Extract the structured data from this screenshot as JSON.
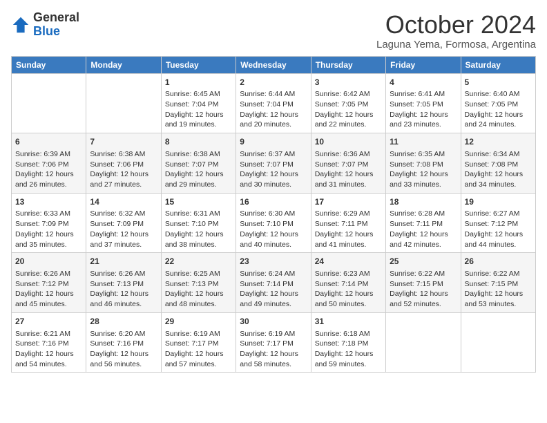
{
  "header": {
    "logo_general": "General",
    "logo_blue": "Blue",
    "month_title": "October 2024",
    "location": "Laguna Yema, Formosa, Argentina"
  },
  "days_of_week": [
    "Sunday",
    "Monday",
    "Tuesday",
    "Wednesday",
    "Thursday",
    "Friday",
    "Saturday"
  ],
  "weeks": [
    [
      {
        "day": "",
        "info": ""
      },
      {
        "day": "",
        "info": ""
      },
      {
        "day": "1",
        "sunrise": "6:45 AM",
        "sunset": "7:04 PM",
        "daylight": "12 hours and 19 minutes."
      },
      {
        "day": "2",
        "sunrise": "6:44 AM",
        "sunset": "7:04 PM",
        "daylight": "12 hours and 20 minutes."
      },
      {
        "day": "3",
        "sunrise": "6:42 AM",
        "sunset": "7:05 PM",
        "daylight": "12 hours and 22 minutes."
      },
      {
        "day": "4",
        "sunrise": "6:41 AM",
        "sunset": "7:05 PM",
        "daylight": "12 hours and 23 minutes."
      },
      {
        "day": "5",
        "sunrise": "6:40 AM",
        "sunset": "7:05 PM",
        "daylight": "12 hours and 24 minutes."
      }
    ],
    [
      {
        "day": "6",
        "sunrise": "6:39 AM",
        "sunset": "7:06 PM",
        "daylight": "12 hours and 26 minutes."
      },
      {
        "day": "7",
        "sunrise": "6:38 AM",
        "sunset": "7:06 PM",
        "daylight": "12 hours and 27 minutes."
      },
      {
        "day": "8",
        "sunrise": "6:38 AM",
        "sunset": "7:07 PM",
        "daylight": "12 hours and 29 minutes."
      },
      {
        "day": "9",
        "sunrise": "6:37 AM",
        "sunset": "7:07 PM",
        "daylight": "12 hours and 30 minutes."
      },
      {
        "day": "10",
        "sunrise": "6:36 AM",
        "sunset": "7:07 PM",
        "daylight": "12 hours and 31 minutes."
      },
      {
        "day": "11",
        "sunrise": "6:35 AM",
        "sunset": "7:08 PM",
        "daylight": "12 hours and 33 minutes."
      },
      {
        "day": "12",
        "sunrise": "6:34 AM",
        "sunset": "7:08 PM",
        "daylight": "12 hours and 34 minutes."
      }
    ],
    [
      {
        "day": "13",
        "sunrise": "6:33 AM",
        "sunset": "7:09 PM",
        "daylight": "12 hours and 35 minutes."
      },
      {
        "day": "14",
        "sunrise": "6:32 AM",
        "sunset": "7:09 PM",
        "daylight": "12 hours and 37 minutes."
      },
      {
        "day": "15",
        "sunrise": "6:31 AM",
        "sunset": "7:10 PM",
        "daylight": "12 hours and 38 minutes."
      },
      {
        "day": "16",
        "sunrise": "6:30 AM",
        "sunset": "7:10 PM",
        "daylight": "12 hours and 40 minutes."
      },
      {
        "day": "17",
        "sunrise": "6:29 AM",
        "sunset": "7:11 PM",
        "daylight": "12 hours and 41 minutes."
      },
      {
        "day": "18",
        "sunrise": "6:28 AM",
        "sunset": "7:11 PM",
        "daylight": "12 hours and 42 minutes."
      },
      {
        "day": "19",
        "sunrise": "6:27 AM",
        "sunset": "7:12 PM",
        "daylight": "12 hours and 44 minutes."
      }
    ],
    [
      {
        "day": "20",
        "sunrise": "6:26 AM",
        "sunset": "7:12 PM",
        "daylight": "12 hours and 45 minutes."
      },
      {
        "day": "21",
        "sunrise": "6:26 AM",
        "sunset": "7:13 PM",
        "daylight": "12 hours and 46 minutes."
      },
      {
        "day": "22",
        "sunrise": "6:25 AM",
        "sunset": "7:13 PM",
        "daylight": "12 hours and 48 minutes."
      },
      {
        "day": "23",
        "sunrise": "6:24 AM",
        "sunset": "7:14 PM",
        "daylight": "12 hours and 49 minutes."
      },
      {
        "day": "24",
        "sunrise": "6:23 AM",
        "sunset": "7:14 PM",
        "daylight": "12 hours and 50 minutes."
      },
      {
        "day": "25",
        "sunrise": "6:22 AM",
        "sunset": "7:15 PM",
        "daylight": "12 hours and 52 minutes."
      },
      {
        "day": "26",
        "sunrise": "6:22 AM",
        "sunset": "7:15 PM",
        "daylight": "12 hours and 53 minutes."
      }
    ],
    [
      {
        "day": "27",
        "sunrise": "6:21 AM",
        "sunset": "7:16 PM",
        "daylight": "12 hours and 54 minutes."
      },
      {
        "day": "28",
        "sunrise": "6:20 AM",
        "sunset": "7:16 PM",
        "daylight": "12 hours and 56 minutes."
      },
      {
        "day": "29",
        "sunrise": "6:19 AM",
        "sunset": "7:17 PM",
        "daylight": "12 hours and 57 minutes."
      },
      {
        "day": "30",
        "sunrise": "6:19 AM",
        "sunset": "7:17 PM",
        "daylight": "12 hours and 58 minutes."
      },
      {
        "day": "31",
        "sunrise": "6:18 AM",
        "sunset": "7:18 PM",
        "daylight": "12 hours and 59 minutes."
      },
      {
        "day": "",
        "info": ""
      },
      {
        "day": "",
        "info": ""
      }
    ]
  ],
  "labels": {
    "sunrise_prefix": "Sunrise: ",
    "sunset_prefix": "Sunset: ",
    "daylight_prefix": "Daylight: "
  }
}
